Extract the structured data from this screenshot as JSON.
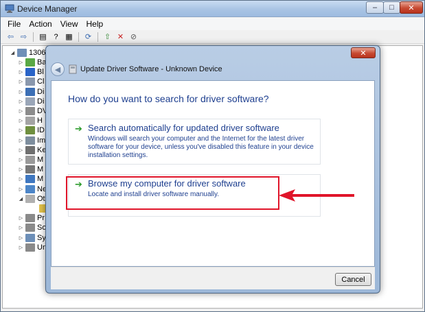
{
  "window": {
    "title": "Device Manager",
    "controls": {
      "minimize": "–",
      "maximize": "□",
      "close": "✕"
    }
  },
  "menu": [
    "File",
    "Action",
    "View",
    "Help"
  ],
  "toolbar": {
    "buttons": [
      {
        "name": "back-icon",
        "glyph": "⇦"
      },
      {
        "name": "forward-icon",
        "glyph": "⇨"
      },
      {
        "name": "properties-icon",
        "glyph": "▤"
      },
      {
        "name": "help-icon",
        "glyph": "?"
      },
      {
        "name": "device-view-icon",
        "glyph": "▦"
      },
      {
        "name": "scan-hardware-icon",
        "glyph": "⟳"
      },
      {
        "name": "update-driver-icon",
        "glyph": "⇧"
      },
      {
        "name": "uninstall-icon",
        "glyph": "✕"
      },
      {
        "name": "disable-icon",
        "glyph": "⊘"
      }
    ]
  },
  "tree": {
    "root": "1306-",
    "items": [
      {
        "label": "Ba",
        "color": "#5aa845"
      },
      {
        "label": "Bl",
        "color": "#2a64c8"
      },
      {
        "label": "Cl",
        "color": "#8a98ad"
      },
      {
        "label": "Di",
        "color": "#3c6fb5"
      },
      {
        "label": "Di",
        "color": "#9aa6b8"
      },
      {
        "label": "DV",
        "color": "#8c8c8c"
      },
      {
        "label": "H",
        "color": "#a4a4a4"
      },
      {
        "label": "ID",
        "color": "#6f8f3f"
      },
      {
        "label": "Im",
        "color": "#7e8e9e"
      },
      {
        "label": "Ke",
        "color": "#707070"
      },
      {
        "label": "M",
        "color": "#9a9a9a"
      },
      {
        "label": "M",
        "color": "#777777"
      },
      {
        "label": "M",
        "color": "#3f77c0"
      },
      {
        "label": "Ne",
        "color": "#4d86c8"
      },
      {
        "label": "Ot",
        "color": "#b0b0b0"
      },
      {
        "label": "",
        "color": "#e2c24a"
      },
      {
        "label": "Pr",
        "color": "#8a8a8a"
      },
      {
        "label": "So",
        "color": "#8a8a8a"
      },
      {
        "label": "Sy",
        "color": "#6d8fb8"
      },
      {
        "label": "Un",
        "color": "#8a8a8a"
      }
    ]
  },
  "dialog": {
    "title": "Update Driver Software - Unknown Device",
    "close": "✕",
    "back": "◀",
    "question": "How do you want to search for driver software?",
    "options": [
      {
        "title": "Search automatically for updated driver software",
        "description": "Windows will search your computer and the Internet for the latest driver software for your device, unless you've disabled this feature in your device installation settings."
      },
      {
        "title": "Browse my computer for driver software",
        "description": "Locate and install driver software manually."
      }
    ],
    "option_arrow": "➔",
    "cancel_label": "Cancel"
  },
  "colors": {
    "link_blue": "#1e3f8f",
    "highlight_red": "#e0152a",
    "arrow_green": "#2c9b2c"
  }
}
